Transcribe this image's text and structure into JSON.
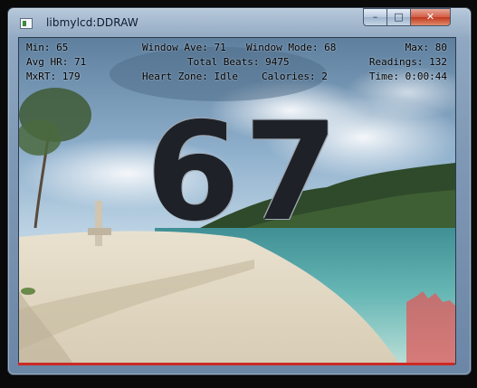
{
  "window": {
    "title": "libmylcd:DDRAW",
    "buttons": {
      "minimize": "–",
      "maximize": "□",
      "close": "✕"
    }
  },
  "hud": {
    "min": "Min: 65",
    "window_ave": "Window Ave: 71",
    "window_mode": "Window Mode: 68",
    "max": "Max: 80",
    "avg_hr": "Avg HR: 71",
    "total_beats": "Total Beats: 9475",
    "readings": "Readings: 132",
    "mxrt": "MxRT: 179",
    "heart_zone": "Heart Zone: Idle",
    "calories": "Calories: 2",
    "time": "Time: 0:00:44"
  },
  "heart_rate": "67",
  "colors": {
    "graph_fill": "#e05a5a",
    "status_bar": "#cc2a25"
  }
}
